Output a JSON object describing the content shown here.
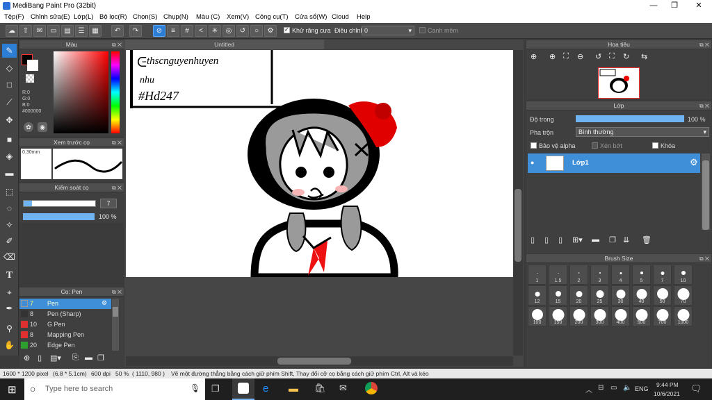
{
  "window": {
    "title": "MediBang Paint Pro (32bit)"
  },
  "menu": [
    "Tệp(F)",
    "Chỉnh sửa(E)",
    "Lớp(L)",
    "Bộ lọc(R)",
    "Chọn(S)",
    "Chụp(N)",
    "Màu (C)",
    "Xem(V)",
    "Công cụ(T)",
    "Cửa sổ(W)",
    "Cloud",
    "Help"
  ],
  "toolbar": {
    "antialias_label": "Khử răng cưa",
    "correction_label": "Điều chỉnh",
    "correction_value": "0",
    "snap_label": "Canh mềm"
  },
  "color_panel": {
    "title": "Màu",
    "r": "R:0",
    "g": "G:0",
    "b": "B:0",
    "hex": "#000000"
  },
  "brush_preview": {
    "title": "Xem trước cọ",
    "size": "0.30mm"
  },
  "brush_control": {
    "title": "Kiểm soát cọ",
    "size_value": "7",
    "opacity_value": "100 %"
  },
  "brush_list": {
    "title": "Cọ: Pen",
    "items": [
      {
        "size": "7",
        "name": "Pen",
        "color": "#333333"
      },
      {
        "size": "8",
        "name": "Pen (Sharp)",
        "color": "#333333"
      },
      {
        "size": "10",
        "name": "G Pen",
        "color": "#e03030"
      },
      {
        "size": "8",
        "name": "Mapping Pen",
        "color": "#e03030"
      },
      {
        "size": "20",
        "name": "Edge Pen",
        "color": "#2ea02e"
      }
    ]
  },
  "document": {
    "tab": "Untitled",
    "handwriting": [
      "thscnguyenhuyen",
      "nhu",
      "#Hd247"
    ]
  },
  "navigator": {
    "title": "Hoa tiêu"
  },
  "layer_panel": {
    "title": "Lớp",
    "opacity_label": "Độ trong",
    "opacity_value": "100 %",
    "blend_label": "Pha trộn",
    "blend_value": "Bình thường",
    "protect_alpha": "Bảo vệ alpha",
    "clip": "Xén bớt",
    "lock": "Khóa",
    "layer_name": "Lớp1"
  },
  "brush_size": {
    "title": "Brush Size",
    "sizes": [
      "1",
      "1.5",
      "2",
      "3",
      "4",
      "5",
      "7",
      "10",
      "12",
      "15",
      "20",
      "25",
      "30",
      "40",
      "50",
      "70",
      "100",
      "150",
      "200",
      "300",
      "400",
      "500",
      "700",
      "1000"
    ]
  },
  "status": {
    "dims": "1600 * 1200 pixel",
    "cm": "(6.8 * 5.1cm)",
    "dpi": "600 dpi",
    "zoom": "50 %",
    "coords": "( 1110, 980 )",
    "hint": "Vẽ một đường thẳng bằng cách giữ phím Shift, Thay đổi cỡ cọ bằng cách giữ phím Ctrl, Alt và kéo"
  },
  "taskbar": {
    "search_placeholder": "Type here to search",
    "lang": "ENG",
    "time": "9:44 PM",
    "date": "10/6/2021"
  }
}
